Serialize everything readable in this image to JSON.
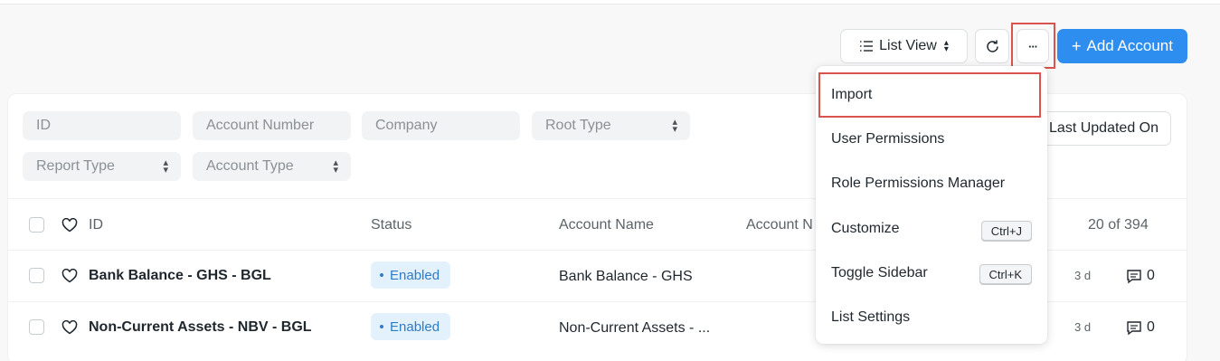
{
  "toolbar": {
    "list_view_label": "List View",
    "add_label": "Add Account",
    "more_label": "···"
  },
  "filters": {
    "id": "ID",
    "account_number": "Account Number",
    "company": "Company",
    "root_type": "Root Type",
    "report_type": "Report Type",
    "account_type": "Account Type"
  },
  "sort": {
    "label": "Last Updated On"
  },
  "table": {
    "headers": {
      "id": "ID",
      "status": "Status",
      "account_name": "Account Name",
      "account_n": "Account N",
      "count": "20 of 394"
    },
    "rows": [
      {
        "id": "Bank Balance - GHS - BGL",
        "status": "Enabled",
        "account_name": "Bank Balance - GHS",
        "age": "3 d",
        "comments": "0"
      },
      {
        "id": "Non-Current Assets - NBV - BGL",
        "status": "Enabled",
        "account_name": "Non-Current Assets - ...",
        "age": "3 d",
        "comments": "0"
      }
    ]
  },
  "menu": {
    "items": [
      {
        "label": "Import"
      },
      {
        "label": "User Permissions"
      },
      {
        "label": "Role Permissions Manager"
      },
      {
        "label": "Customize",
        "shortcut": "Ctrl+J"
      },
      {
        "label": "Toggle Sidebar",
        "shortcut": "Ctrl+K"
      },
      {
        "label": "List Settings"
      }
    ]
  },
  "colors": {
    "primary": "#2d8ef0",
    "highlight": "#d9534f",
    "badge_bg": "#e3f1fd",
    "badge_text": "#2d7cc8"
  }
}
